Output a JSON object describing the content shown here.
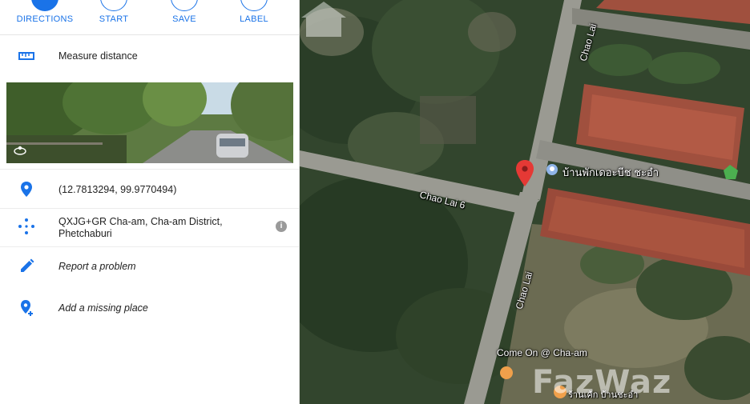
{
  "actions": [
    {
      "label": "DIRECTIONS",
      "icon": "directions-icon"
    },
    {
      "label": "START",
      "icon": "navigation-icon"
    },
    {
      "label": "SAVE",
      "icon": "bookmark-icon"
    },
    {
      "label": "LABEL",
      "icon": "flag-icon"
    }
  ],
  "measure": {
    "label": "Measure distance",
    "icon": "ruler-icon"
  },
  "photo": {
    "icon": "street-view-pano-icon"
  },
  "coordinates": {
    "text": "(12.7813294, 99.9770494)",
    "icon": "location-pin-icon"
  },
  "plus_code": {
    "text": "QXJG+GR Cha-am, Cha-am District, Phetchaburi",
    "icon": "plus-code-icon",
    "info": "i"
  },
  "report": {
    "label": "Report a problem",
    "icon": "pencil-icon"
  },
  "missing_place": {
    "label": "Add a missing place",
    "icon": "add-place-icon"
  },
  "map": {
    "roads": [
      "Chao Lai 6",
      "Chao Lai",
      "Chao Lai"
    ],
    "places": [
      "บ้านพักเดอะบีช ชะอำ",
      "Come On @ Cha-am",
      "ร้านเค้ก บ้านชะอำ"
    ],
    "watermark": "FazWaz",
    "pin_color": "#e53935",
    "accent": "#1a73e8"
  }
}
